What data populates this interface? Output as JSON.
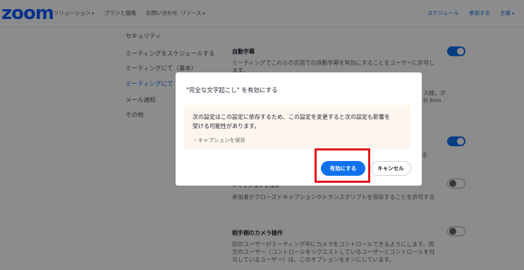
{
  "topnav": {
    "logo": "zoom",
    "items": [
      "ソリューション",
      "プランと価格",
      "お問い合わせ",
      "リソース"
    ],
    "right": [
      "スケジュール",
      "参加する",
      "主催"
    ]
  },
  "leftnav": {
    "items": [
      "セキュリティ",
      "ミーティングをスケジュールする",
      "ミーティングにて（基本）",
      "ミーティングにて",
      "メール通知",
      "その他"
    ]
  },
  "settings": {
    "auto_caption_title": "自動字幕",
    "auto_caption_desc_1": "ミーティングでこれらの言語での自動字幕を有効にすることをユーザーに許可し",
    "auto_caption_desc_2": "ます。",
    "side_fragment_1": "ス線，ボ",
    "side_fragment_2": "訳 Beta",
    "side_fragment_3": "る",
    "caption_save_title": "キャプションを保存",
    "caption_save_desc": "参加者がクローズドキャプションやトランスクリプトを保存することを許可する",
    "camera_title": "相手側のカメラ操作",
    "camera_desc_1": "別のユーザーがミーティング中にカメラをコントロールできるようにします。両",
    "camera_desc_2": "方のユーザー（コントロールをリクエストしているユーザーとコントロールを付",
    "camera_desc_3": "与しているユーザー）は、このオプションをオンにしています。"
  },
  "modal": {
    "title": "\"完全な文字起こし\" を有効にする",
    "warn_line_1": "次の設定はこの設定に依存するため、この設定を変更すると次の設定も影響を",
    "warn_line_2": "受ける可能性があります。",
    "warn_bullet": "・キャプションを保存",
    "enable_label": "有効にする",
    "cancel_label": "キャンセル"
  },
  "colors": {
    "accent": "#0e72ed",
    "highlight": "#e8141b",
    "warn_bg": "#fdf6ef"
  }
}
